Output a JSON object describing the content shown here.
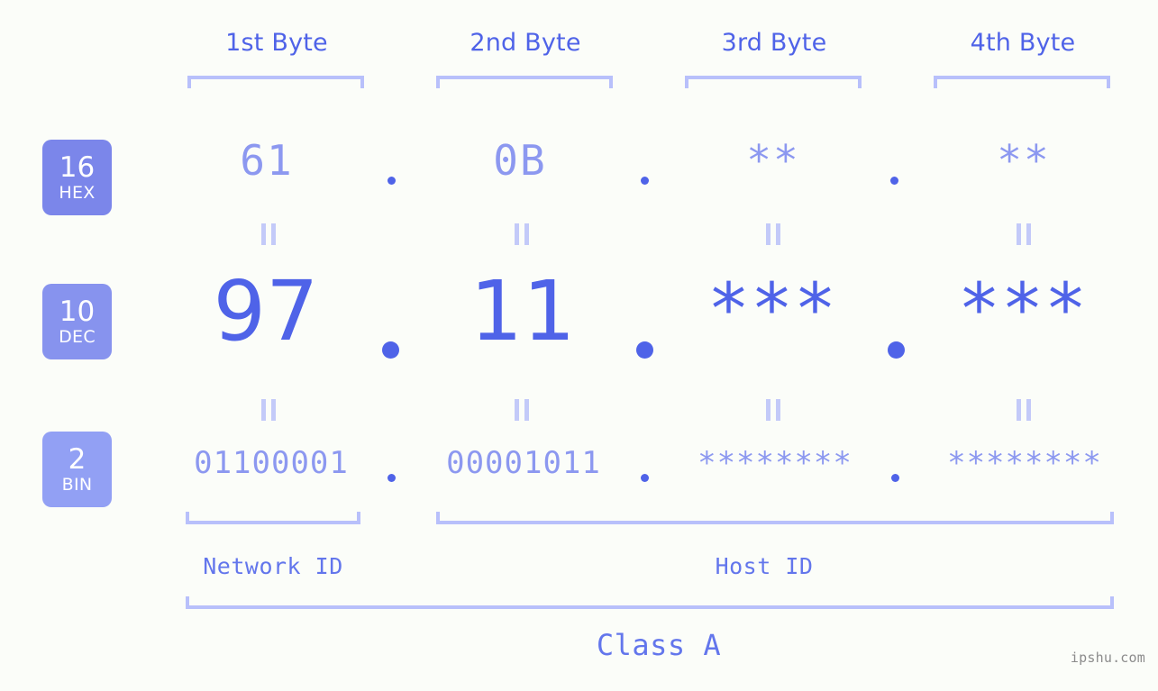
{
  "meta": {
    "background": "#fbfdf9",
    "accent_strong": "#4f63e8",
    "accent_mid": "#8c98f0",
    "accent_light": "#b8c0fb",
    "watermark": "ipshu.com"
  },
  "byte_headers": [
    {
      "label": "1st Byte"
    },
    {
      "label": "2nd Byte"
    },
    {
      "label": "3rd Byte"
    },
    {
      "label": "4th Byte"
    }
  ],
  "radix_badges": [
    {
      "num": "16",
      "abbr": "HEX",
      "color": "#7b86ea"
    },
    {
      "num": "10",
      "abbr": "DEC",
      "color": "#8793ee"
    },
    {
      "num": "2",
      "abbr": "BIN",
      "color": "#92a0f4"
    }
  ],
  "rows": {
    "hex": {
      "values": [
        "61",
        "0B",
        "**",
        "**"
      ]
    },
    "dec": {
      "values": [
        "97",
        "11",
        "***",
        "***"
      ]
    },
    "bin": {
      "values": [
        "01100001",
        "00001011",
        "********",
        "********"
      ]
    }
  },
  "separators": {
    "dot": "."
  },
  "equals": {
    "glyph": "||"
  },
  "segments": {
    "network_id": "Network ID",
    "host_id": "Host ID",
    "class": "Class A"
  }
}
